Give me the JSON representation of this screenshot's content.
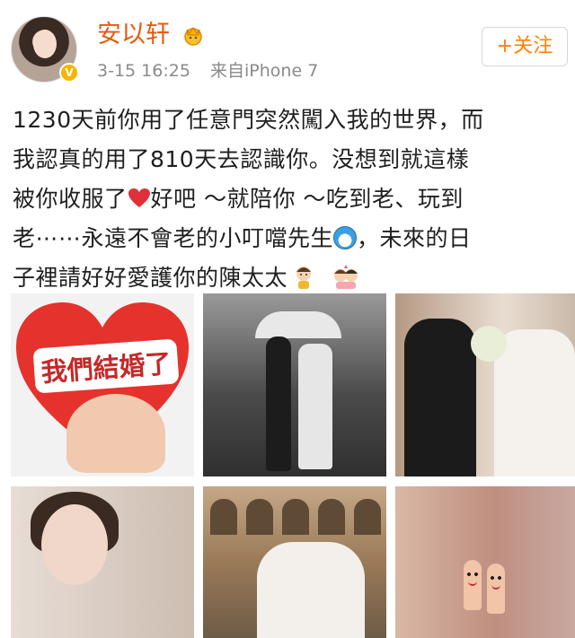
{
  "header": {
    "username": "安以轩",
    "timestamp": "3-15 16:25",
    "source": "来自iPhone 7",
    "follow_label": "+关注",
    "verified_badge": "V"
  },
  "post": {
    "line1": "1230天前你用了任意門突然闖入我的世界，而",
    "line2": "我認真的用了810天去認識你。没想到就這樣",
    "line3_before": "被你收服了",
    "line3_after": "好吧 ～就陪你 ～吃到老、玩到",
    "line4_before": "老⋯⋯永遠不會老的小叮噹先生",
    "line4_after": "，未來的日",
    "line5": "子裡請好好愛護你的陳太太"
  },
  "photos": {
    "photo1_text": "我們結婚了"
  },
  "icons": {
    "crown": "crown-badge-icon",
    "heart": "red-heart-emoji",
    "doraemon": "doraemon-emoji",
    "couple": "couple-emoji"
  },
  "colors": {
    "username": "#e8590c",
    "follow": "#ff8200",
    "heart": "#e0303a"
  }
}
